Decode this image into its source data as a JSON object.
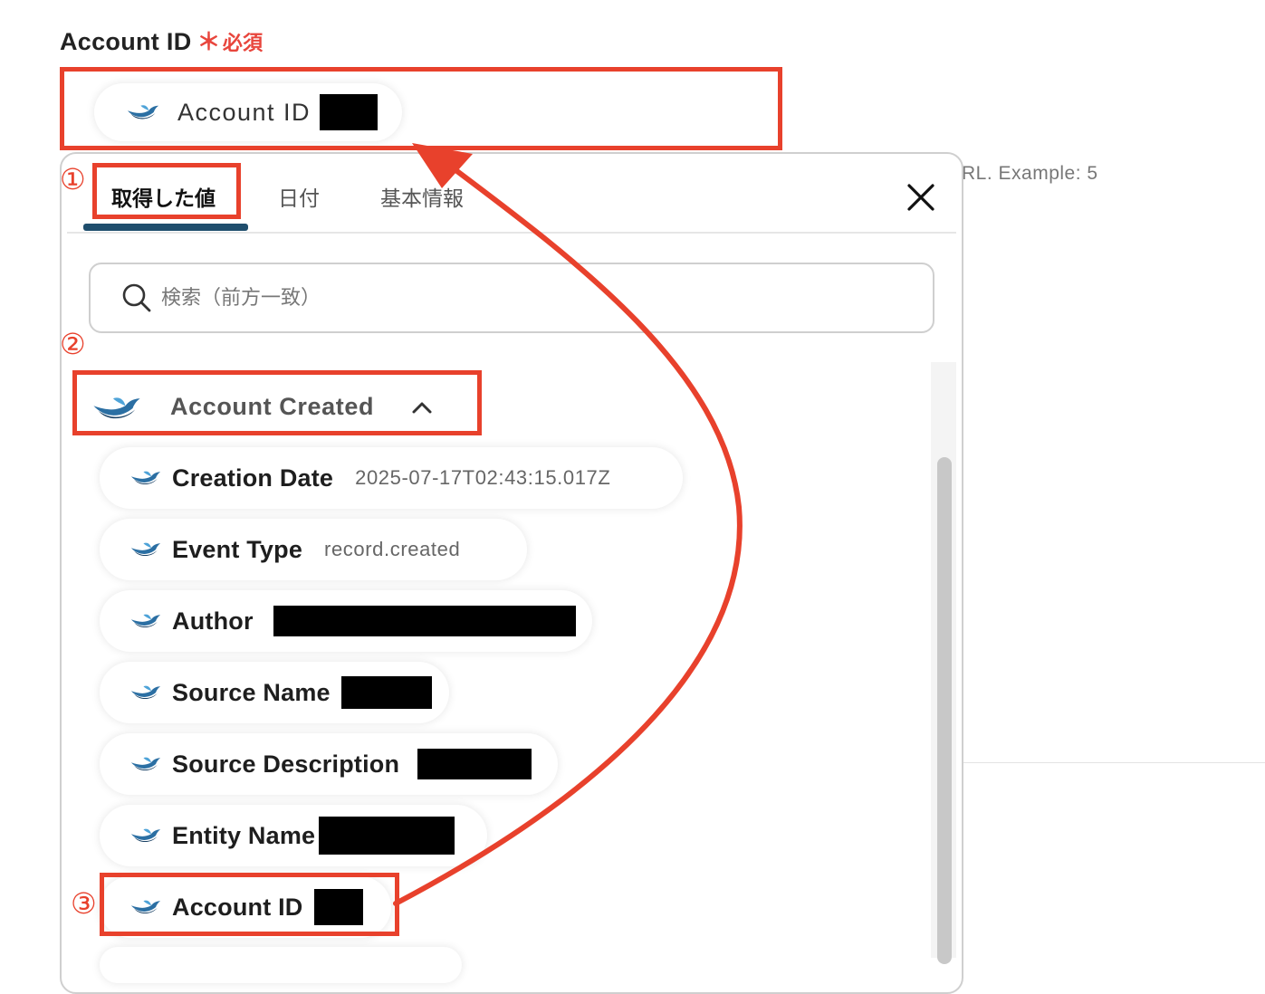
{
  "field": {
    "label": "Account ID",
    "required_mark": "＊",
    "required_text": "必須",
    "selected_chip_label": "Account ID"
  },
  "side_hint": "RL. Example: 5",
  "annotations": {
    "step1": "①",
    "step2": "②",
    "step3": "③"
  },
  "panel": {
    "tabs": [
      {
        "label": "取得した値",
        "active": true
      },
      {
        "label": "日付",
        "active": false
      },
      {
        "label": "基本情報",
        "active": false
      }
    ],
    "search_placeholder": "検索（前方一致）",
    "group_title": "Account Created",
    "items": [
      {
        "label": "Creation Date",
        "value": "2025-07-17T02:43:15.017Z"
      },
      {
        "label": "Event Type",
        "value": "record.created"
      },
      {
        "label": "Author",
        "value": ""
      },
      {
        "label": "Source Name",
        "value": ""
      },
      {
        "label": "Source Description",
        "value": ""
      },
      {
        "label": "Entity Name",
        "value": ""
      },
      {
        "label": "Account ID",
        "value": ""
      }
    ]
  },
  "colors": {
    "annotation_red": "#e8412c",
    "tab_underline": "#1f4e6d",
    "required": "#e8453c"
  }
}
